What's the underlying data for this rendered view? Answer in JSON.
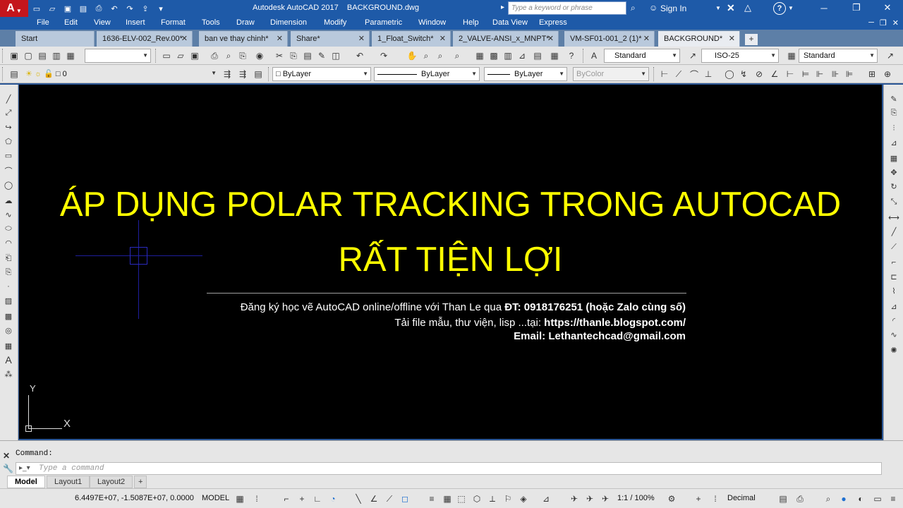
{
  "app": {
    "title": "Autodesk AutoCAD 2017    BACKGROUND.dwg",
    "logo_letter": "A",
    "search_placeholder": "Type a keyword or phrase",
    "sign_in": "Sign In"
  },
  "menu": [
    "File",
    "Edit",
    "View",
    "Insert",
    "Format",
    "Tools",
    "Draw",
    "Dimension",
    "Modify",
    "Parametric",
    "Window",
    "Help",
    "Data View",
    "Express"
  ],
  "file_tabs": [
    {
      "label": "Start",
      "closable": false
    },
    {
      "label": "1636-ELV-002_Rev.00*",
      "closable": true
    },
    {
      "label": "ban ve thay chinh*",
      "closable": true
    },
    {
      "label": "Share*",
      "closable": true
    },
    {
      "label": "1_Float_Switch*",
      "closable": true
    },
    {
      "label": "2_VALVE-ANSI_x_MNPT*",
      "closable": true
    },
    {
      "label": "VM-SF01-001_2 (1)*",
      "closable": true
    },
    {
      "label": "BACKGROUND*",
      "closable": true,
      "active": true
    }
  ],
  "toolbar1": {
    "text_style": "Standard",
    "dim_style": "ISO-25",
    "table_style": "Standard"
  },
  "toolbar2": {
    "layer": "0",
    "color": "ByLayer",
    "linetype": "ByLayer",
    "lineweight": "ByLayer",
    "plotstyle": "ByColor"
  },
  "drawing": {
    "headline_line1": "ÁP DỤNG POLAR TRACKING TRONG AUTOCAD",
    "headline_line2": "RẤT TIỆN LỢI",
    "info_line1_prefix": "Đăng ký học vẽ AutoCAD online/offline với Than Le qua ",
    "info_line1_bold": "ĐT: 0918176251 (hoặc Zalo cùng số)",
    "info_line2_prefix": "Tải file mẫu, thư viện, lisp ...tại:  ",
    "info_line2_bold": "https://thanle.blogspot.com/",
    "info_line3": "Email: Lethantechcad@gmail.com",
    "ucs_x": "X",
    "ucs_y": "Y",
    "text_color": "#ffff00",
    "background": "#000000"
  },
  "command": {
    "history": "Command:",
    "placeholder": "Type a command"
  },
  "layout_tabs": [
    "Model",
    "Layout1",
    "Layout2"
  ],
  "status": {
    "coords": "6.4497E+07, -1.5087E+07, 0.0000",
    "space": "MODEL",
    "annotation_scale": "1:1 / 100%",
    "units": "Decimal"
  }
}
